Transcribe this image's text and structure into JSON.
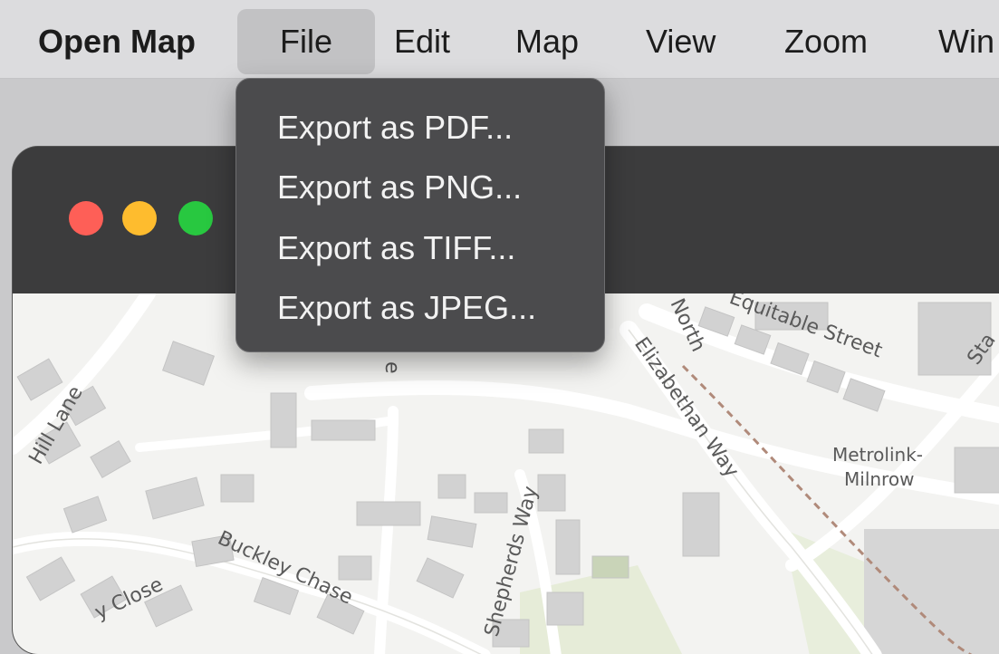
{
  "menubar": {
    "app_name": "Open Map",
    "items": [
      "File",
      "Edit",
      "Map",
      "View",
      "Zoom",
      "Win"
    ]
  },
  "file_menu": {
    "items": [
      "Export as PDF...",
      "Export as PNG...",
      "Export as TIFF...",
      "Export as JPEG..."
    ]
  },
  "window": {
    "traffic_lights": {
      "close": "#fe5f57",
      "minimize": "#febc2e",
      "maximize": "#28c840"
    }
  },
  "map": {
    "labels": {
      "hill_lane": "Hill Lane",
      "close": "y Close",
      "buckley_chase": "Buckley Chase",
      "shepherds_way": "Shepherds Way",
      "north": "North",
      "elizabethan_way": "Elizabethan Way",
      "equitable_street": "Equitable Street",
      "sta": "Sta",
      "station_line1": "Metrolink-",
      "station_line2": "Milnrow",
      "e_fragment": "e"
    }
  }
}
